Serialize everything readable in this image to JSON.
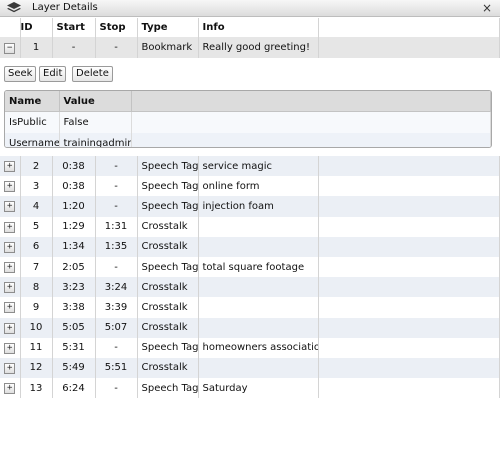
{
  "window": {
    "title": "Layer Details",
    "icon": "layers-icon",
    "close_glyph": "×"
  },
  "columns": {
    "id": "ID",
    "start": "Start",
    "stop": "Stop",
    "type": "Type",
    "info": "Info"
  },
  "expanded_row": {
    "id": "1",
    "start": "-",
    "stop": "-",
    "type": "Bookmark",
    "info": "Really good greeting!",
    "toggle": "−"
  },
  "actions": {
    "seek": "Seek",
    "edit": "Edit",
    "delete": "Delete"
  },
  "details": {
    "headers": {
      "name": "Name",
      "value": "Value"
    },
    "rows": [
      {
        "name": "IsPublic",
        "value": "False"
      },
      {
        "name": "Username",
        "value": "trainingadmin"
      }
    ]
  },
  "rows": [
    {
      "id": "2",
      "start": "0:38",
      "stop": "-",
      "type": "Speech Tag",
      "info": "service magic"
    },
    {
      "id": "3",
      "start": "0:38",
      "stop": "-",
      "type": "Speech Tag",
      "info": "online form"
    },
    {
      "id": "4",
      "start": "1:20",
      "stop": "-",
      "type": "Speech Tag",
      "info": "injection foam"
    },
    {
      "id": "5",
      "start": "1:29",
      "stop": "1:31",
      "type": "Crosstalk",
      "info": ""
    },
    {
      "id": "6",
      "start": "1:34",
      "stop": "1:35",
      "type": "Crosstalk",
      "info": ""
    },
    {
      "id": "7",
      "start": "2:05",
      "stop": "-",
      "type": "Speech Tag",
      "info": "total square footage"
    },
    {
      "id": "8",
      "start": "3:23",
      "stop": "3:24",
      "type": "Crosstalk",
      "info": ""
    },
    {
      "id": "9",
      "start": "3:38",
      "stop": "3:39",
      "type": "Crosstalk",
      "info": ""
    },
    {
      "id": "10",
      "start": "5:05",
      "stop": "5:07",
      "type": "Crosstalk",
      "info": ""
    },
    {
      "id": "11",
      "start": "5:31",
      "stop": "-",
      "type": "Speech Tag",
      "info": "homeowners association"
    },
    {
      "id": "12",
      "start": "5:49",
      "stop": "5:51",
      "type": "Crosstalk",
      "info": ""
    },
    {
      "id": "13",
      "start": "6:24",
      "stop": "-",
      "type": "Speech Tag",
      "info": "Saturday"
    }
  ],
  "expand_glyph": "+"
}
